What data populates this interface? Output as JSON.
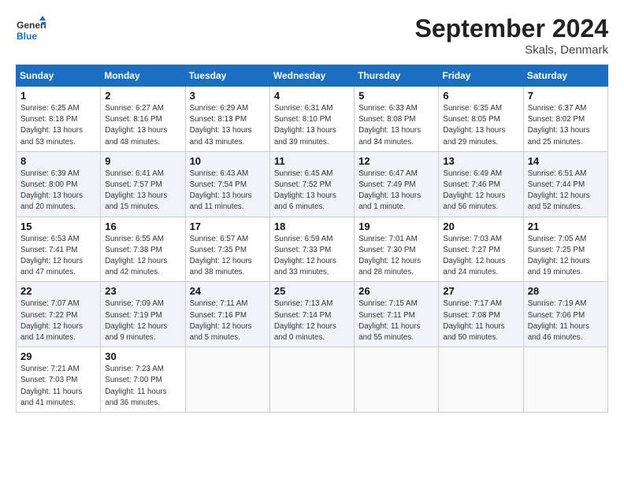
{
  "header": {
    "logo_general": "General",
    "logo_blue": "Blue",
    "month_title": "September 2024",
    "location": "Skals, Denmark"
  },
  "columns": [
    "Sunday",
    "Monday",
    "Tuesday",
    "Wednesday",
    "Thursday",
    "Friday",
    "Saturday"
  ],
  "weeks": [
    [
      {
        "day": "1",
        "info": "Sunrise: 6:25 AM\nSunset: 8:18 PM\nDaylight: 13 hours\nand 53 minutes."
      },
      {
        "day": "2",
        "info": "Sunrise: 6:27 AM\nSunset: 8:16 PM\nDaylight: 13 hours\nand 48 minutes."
      },
      {
        "day": "3",
        "info": "Sunrise: 6:29 AM\nSunset: 8:13 PM\nDaylight: 13 hours\nand 43 minutes."
      },
      {
        "day": "4",
        "info": "Sunrise: 6:31 AM\nSunset: 8:10 PM\nDaylight: 13 hours\nand 39 minutes."
      },
      {
        "day": "5",
        "info": "Sunrise: 6:33 AM\nSunset: 8:08 PM\nDaylight: 13 hours\nand 34 minutes."
      },
      {
        "day": "6",
        "info": "Sunrise: 6:35 AM\nSunset: 8:05 PM\nDaylight: 13 hours\nand 29 minutes."
      },
      {
        "day": "7",
        "info": "Sunrise: 6:37 AM\nSunset: 8:02 PM\nDaylight: 13 hours\nand 25 minutes."
      }
    ],
    [
      {
        "day": "8",
        "info": "Sunrise: 6:39 AM\nSunset: 8:00 PM\nDaylight: 13 hours\nand 20 minutes."
      },
      {
        "day": "9",
        "info": "Sunrise: 6:41 AM\nSunset: 7:57 PM\nDaylight: 13 hours\nand 15 minutes."
      },
      {
        "day": "10",
        "info": "Sunrise: 6:43 AM\nSunset: 7:54 PM\nDaylight: 13 hours\nand 11 minutes."
      },
      {
        "day": "11",
        "info": "Sunrise: 6:45 AM\nSunset: 7:52 PM\nDaylight: 13 hours\nand 6 minutes."
      },
      {
        "day": "12",
        "info": "Sunrise: 6:47 AM\nSunset: 7:49 PM\nDaylight: 13 hours\nand 1 minute."
      },
      {
        "day": "13",
        "info": "Sunrise: 6:49 AM\nSunset: 7:46 PM\nDaylight: 12 hours\nand 56 minutes."
      },
      {
        "day": "14",
        "info": "Sunrise: 6:51 AM\nSunset: 7:44 PM\nDaylight: 12 hours\nand 52 minutes."
      }
    ],
    [
      {
        "day": "15",
        "info": "Sunrise: 6:53 AM\nSunset: 7:41 PM\nDaylight: 12 hours\nand 47 minutes."
      },
      {
        "day": "16",
        "info": "Sunrise: 6:55 AM\nSunset: 7:38 PM\nDaylight: 12 hours\nand 42 minutes."
      },
      {
        "day": "17",
        "info": "Sunrise: 6:57 AM\nSunset: 7:35 PM\nDaylight: 12 hours\nand 38 minutes."
      },
      {
        "day": "18",
        "info": "Sunrise: 6:59 AM\nSunset: 7:33 PM\nDaylight: 12 hours\nand 33 minutes."
      },
      {
        "day": "19",
        "info": "Sunrise: 7:01 AM\nSunset: 7:30 PM\nDaylight: 12 hours\nand 28 minutes."
      },
      {
        "day": "20",
        "info": "Sunrise: 7:03 AM\nSunset: 7:27 PM\nDaylight: 12 hours\nand 24 minutes."
      },
      {
        "day": "21",
        "info": "Sunrise: 7:05 AM\nSunset: 7:25 PM\nDaylight: 12 hours\nand 19 minutes."
      }
    ],
    [
      {
        "day": "22",
        "info": "Sunrise: 7:07 AM\nSunset: 7:22 PM\nDaylight: 12 hours\nand 14 minutes."
      },
      {
        "day": "23",
        "info": "Sunrise: 7:09 AM\nSunset: 7:19 PM\nDaylight: 12 hours\nand 9 minutes."
      },
      {
        "day": "24",
        "info": "Sunrise: 7:11 AM\nSunset: 7:16 PM\nDaylight: 12 hours\nand 5 minutes."
      },
      {
        "day": "25",
        "info": "Sunrise: 7:13 AM\nSunset: 7:14 PM\nDaylight: 12 hours\nand 0 minutes."
      },
      {
        "day": "26",
        "info": "Sunrise: 7:15 AM\nSunset: 7:11 PM\nDaylight: 11 hours\nand 55 minutes."
      },
      {
        "day": "27",
        "info": "Sunrise: 7:17 AM\nSunset: 7:08 PM\nDaylight: 11 hours\nand 50 minutes."
      },
      {
        "day": "28",
        "info": "Sunrise: 7:19 AM\nSunset: 7:06 PM\nDaylight: 11 hours\nand 46 minutes."
      }
    ],
    [
      {
        "day": "29",
        "info": "Sunrise: 7:21 AM\nSunset: 7:03 PM\nDaylight: 11 hours\nand 41 minutes."
      },
      {
        "day": "30",
        "info": "Sunrise: 7:23 AM\nSunset: 7:00 PM\nDaylight: 11 hours\nand 36 minutes."
      },
      {
        "day": "",
        "info": ""
      },
      {
        "day": "",
        "info": ""
      },
      {
        "day": "",
        "info": ""
      },
      {
        "day": "",
        "info": ""
      },
      {
        "day": "",
        "info": ""
      }
    ]
  ]
}
